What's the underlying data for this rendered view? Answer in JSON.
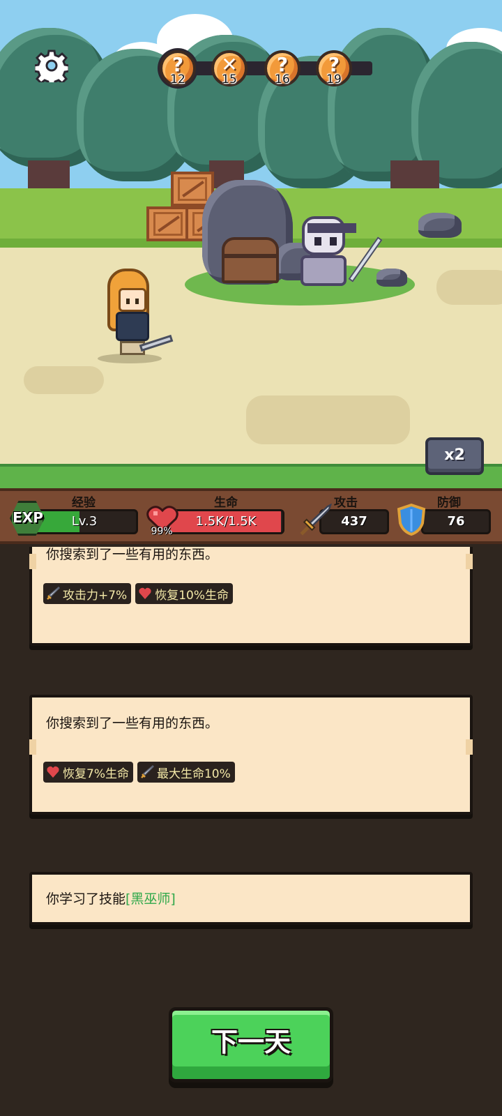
{
  "progress": {
    "nodes": [
      {
        "mark": "?",
        "day": "12",
        "current": true
      },
      {
        "mark": "✕",
        "day": "15",
        "current": false
      },
      {
        "mark": "?",
        "day": "16",
        "current": false
      },
      {
        "mark": "?",
        "day": "19",
        "current": false
      }
    ]
  },
  "speed_label": "x2",
  "stats": {
    "exp": {
      "label": "经验",
      "badge": "EXP",
      "level": "Lv.3",
      "fill": 0.45,
      "color": "#37a83a"
    },
    "hp": {
      "label": "生命",
      "value": "1.5K/1.5K",
      "percent": "99%",
      "fill": 0.99,
      "color": "#e0474c"
    },
    "atk": {
      "label": "攻击",
      "value": "437"
    },
    "def": {
      "label": "防御",
      "value": "76"
    }
  },
  "log": [
    {
      "message": "你搜索到了一些有用的东西。",
      "tags": [
        {
          "icon": "sword-icon",
          "text": "攻击力+7%"
        },
        {
          "icon": "heart-icon",
          "text": "恢复10%生命"
        }
      ]
    },
    {
      "message": "你搜索到了一些有用的东西。",
      "tags": [
        {
          "icon": "heart-icon",
          "text": "恢复7%生命"
        },
        {
          "icon": "sword-icon",
          "text": "最大生命10%"
        }
      ]
    },
    {
      "message_prefix": "你学习了技能",
      "skill": "[黑巫师]",
      "skill_color": "#2fa84a"
    }
  ],
  "next_button": "下一天",
  "colors": {
    "accent_green": "#4cd25a",
    "log_bg": "#2f261f",
    "card_bg": "#fbe6c6"
  }
}
